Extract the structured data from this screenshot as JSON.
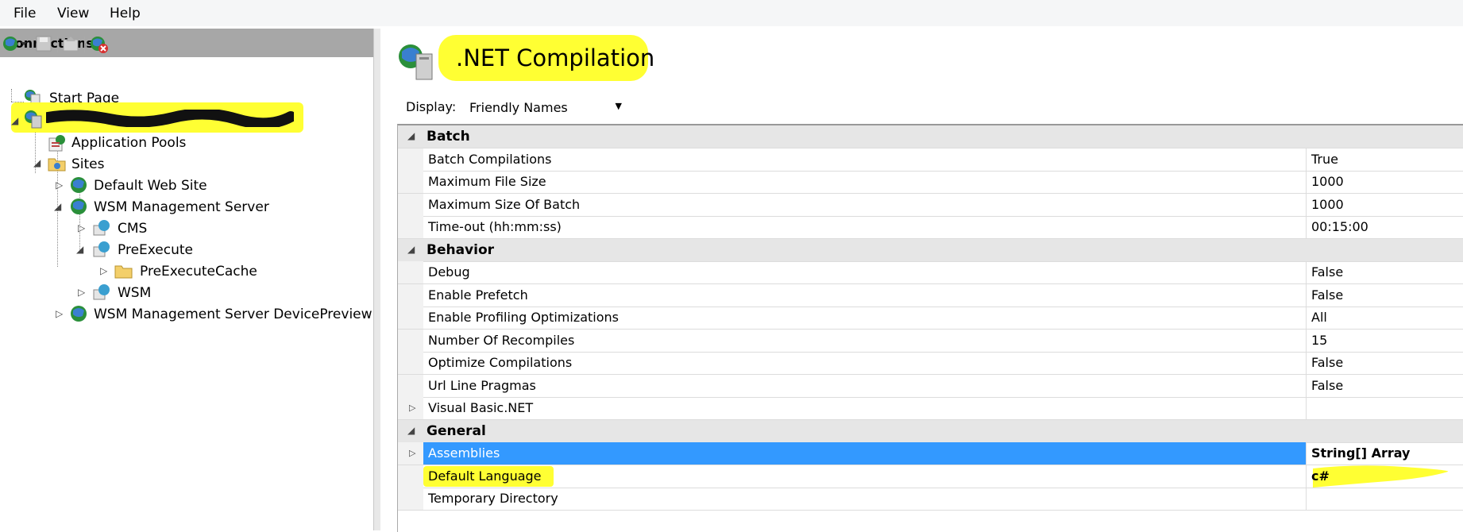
{
  "menu": {
    "items": [
      "File",
      "View",
      "Help"
    ]
  },
  "connections": {
    "title": "Connections",
    "tree": [
      {
        "label": "Start Page"
      },
      {
        "label": ""
      },
      {
        "label": "Application Pools"
      },
      {
        "label": "Sites"
      },
      {
        "label": "Default Web Site"
      },
      {
        "label": "WSM Management Server"
      },
      {
        "label": "CMS"
      },
      {
        "label": "PreExecute"
      },
      {
        "label": "PreExecuteCache"
      },
      {
        "label": "WSM"
      },
      {
        "label": "WSM Management Server DevicePreview"
      }
    ]
  },
  "page": {
    "title": ".NET Compilation",
    "display_label": "Display:",
    "display_value": "Friendly Names"
  },
  "grid": {
    "categories": {
      "batch": "Batch",
      "behavior": "Behavior",
      "general": "General"
    },
    "batch": [
      {
        "name": "Batch Compilations",
        "value": "True"
      },
      {
        "name": "Maximum File Size",
        "value": "1000"
      },
      {
        "name": "Maximum Size Of Batch",
        "value": "1000"
      },
      {
        "name": "Time-out (hh:mm:ss)",
        "value": "00:15:00"
      }
    ],
    "behavior": [
      {
        "name": "Debug",
        "value": "False"
      },
      {
        "name": "Enable Prefetch",
        "value": "False"
      },
      {
        "name": "Enable Profiling Optimizations",
        "value": "All"
      },
      {
        "name": "Number Of Recompiles",
        "value": "15"
      },
      {
        "name": "Optimize Compilations",
        "value": "False"
      },
      {
        "name": "Url Line Pragmas",
        "value": "False"
      },
      {
        "name": "Visual Basic.NET",
        "value": ""
      }
    ],
    "general": [
      {
        "name": "Assemblies",
        "value": "String[] Array"
      },
      {
        "name": "Default Language",
        "value": "c#"
      },
      {
        "name": "Temporary Directory",
        "value": ""
      }
    ]
  },
  "colors": {
    "highlight": "#ffff33",
    "selection": "#3399ff",
    "category_bg": "#e6e6e6"
  }
}
